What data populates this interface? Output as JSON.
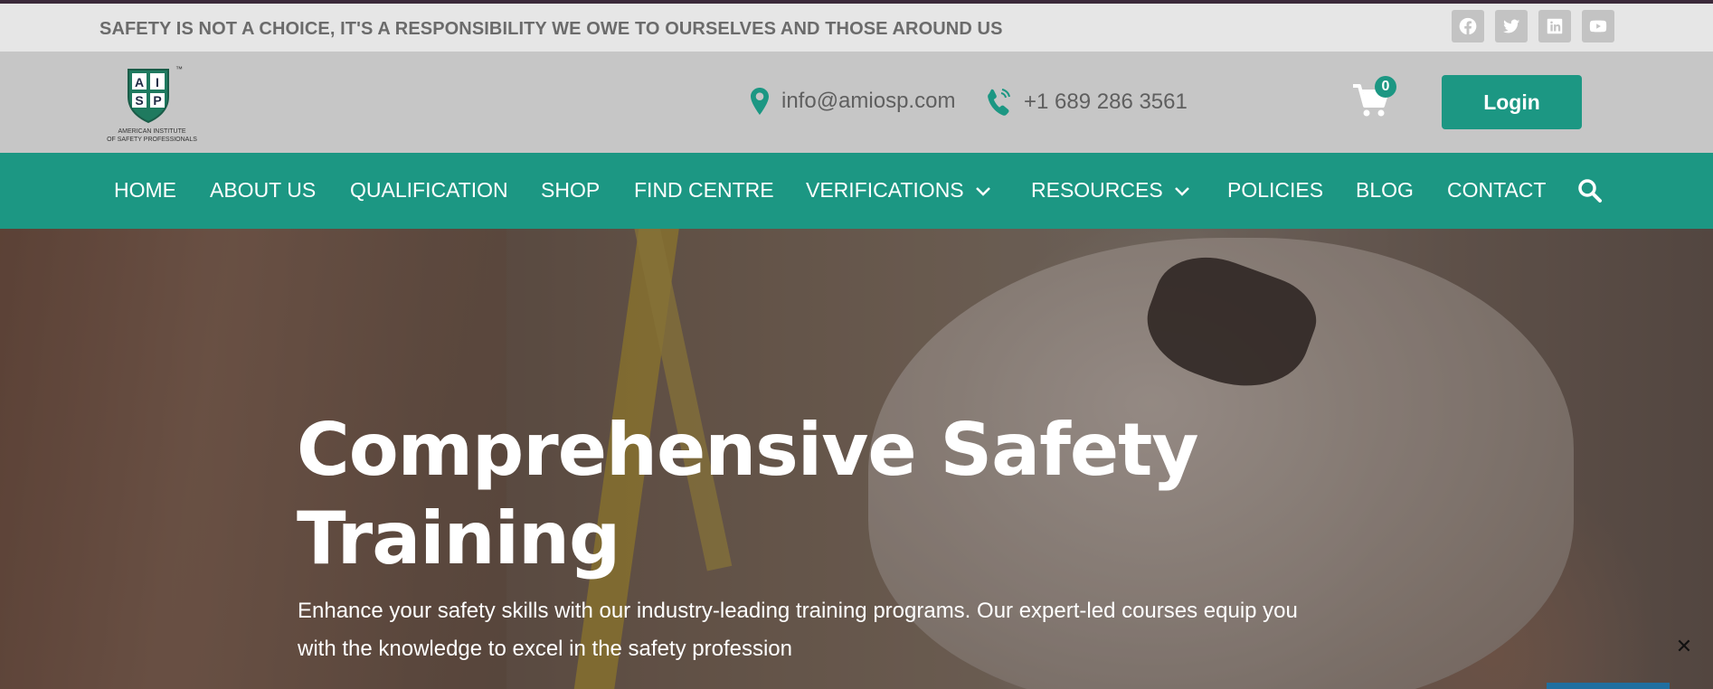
{
  "topbar": {
    "tagline": "SAFETY IS NOT A CHOICE, IT'S A RESPONSIBILITY WE OWE TO OURSELVES AND THOSE AROUND US",
    "social": [
      "facebook-icon",
      "twitter-icon",
      "linkedin-icon",
      "youtube-icon"
    ]
  },
  "header": {
    "logo_letters": [
      "A",
      "I",
      "S",
      "P"
    ],
    "logo_tm": "™",
    "logo_caption_1": "AMERICAN INSTITUTE",
    "logo_caption_2": "OF SAFETY PROFESSIONALS",
    "email": "info@amiosp.com",
    "phone": "+1 689 286 3561",
    "cart_count": "0",
    "login_label": "Login"
  },
  "nav": {
    "items": [
      {
        "label": "HOME"
      },
      {
        "label": "ABOUT US"
      },
      {
        "label": "QUALIFICATION"
      },
      {
        "label": "SHOP"
      },
      {
        "label": "FIND CENTRE"
      },
      {
        "label": "VERIFICATIONS"
      },
      {
        "label": "RESOURCES"
      },
      {
        "label": "POLICIES"
      },
      {
        "label": "BLOG"
      },
      {
        "label": "CONTACT"
      }
    ]
  },
  "hero": {
    "title_line1": "Comprehensive Safety",
    "title_line2": "Training",
    "text_line1": "Enhance your safety skills with our industry-leading training programs. Our expert-led courses equip you",
    "text_line2": "with the knowledge to excel in the safety profession",
    "close_label": "✕"
  },
  "colors": {
    "accent": "#1c9783",
    "topbar_bg": "#e6e6e6",
    "header_bg": "#c6c6c6"
  }
}
